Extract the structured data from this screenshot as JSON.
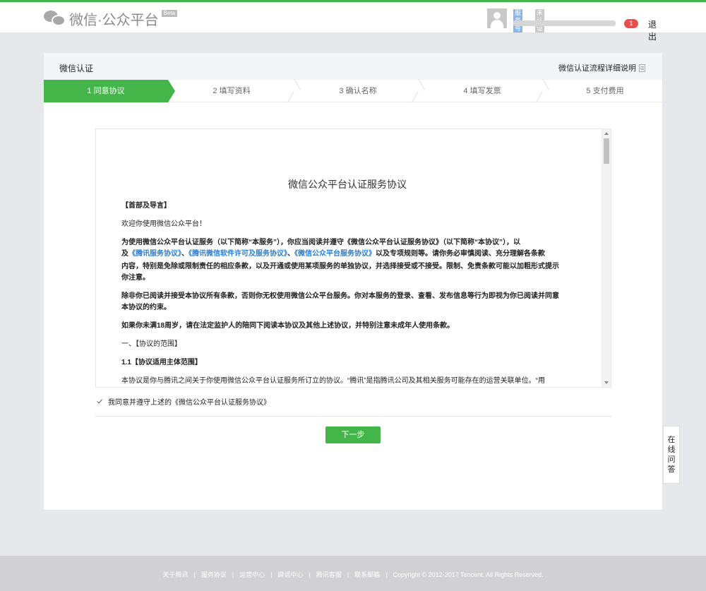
{
  "header": {
    "logo_text": "微信·公众平台",
    "logo_beta": "Beta",
    "account_type": "服务号",
    "account_status": "未认证",
    "notice_count": "1",
    "logout": "退出"
  },
  "card": {
    "title": "微信认证",
    "process_link": "微信认证流程详细说明"
  },
  "steps": [
    {
      "label": "1 同意协议",
      "active": true
    },
    {
      "label": "2 填写资料",
      "active": false
    },
    {
      "label": "3 确认名称",
      "active": false
    },
    {
      "label": "4 填写发票",
      "active": false
    },
    {
      "label": "5 支付费用",
      "active": false
    }
  ],
  "agreement": {
    "title": "微信公众平台认证服务协议",
    "section_head": "【首部及导言】",
    "welcome": "欢迎你使用微信公众平台！",
    "p1_a": "为使用微信公众平台认证服务（以下简称“本服务”），你应当阅读并遵守《微信公众平台认证服务协议》（以下简称“本协议”），以",
    "p1_b_prefix": "及",
    "link1": "《腾讯服务协议》",
    "link2": "《腾讯微信软件许可及服务协议》",
    "link3": "《微信公众平台服务协议》",
    "p1_b_suffix": "以及专项规则等。请你务必审慎阅读、充分理解各条款",
    "p1_c": "内容，特别是免除或限制责任的相应条款，以及开通或使用某项服务的单独协议，并选择接受或不接受。限制、免责条款可能以加粗形式提示",
    "p1_d": "你注意。",
    "p2_a": "除非你已阅读并接受本协议所有条款，否则你无权使用微信公众平台服务。你对本服务的登录、查看、发布信息等行为即视为你已阅读并同意",
    "p2_b": "本协议的约束。",
    "p3": "如果你未满18周岁，请在法定监护人的陪同下阅读本协议及其他上述协议，并特别注意未成年人使用条款。",
    "s1": "一、【协议的范围】",
    "s1_1": "1.1【协议适用主体范围】",
    "p4": "本协议是你与腾讯之间关于你使用微信公众平台认证服务所订立的协议。“腾讯”是指腾讯公司及其相关服务可能存在的运营关联单位。“用"
  },
  "agree_label": "我同意并遵守上述的《微信公众平台认证服务协议》",
  "next_button": "下一步",
  "online_help": [
    "在",
    "线",
    "问",
    "答"
  ],
  "footer": {
    "links": [
      "关于腾讯",
      "服务协议",
      "运营中心",
      "辟谣中心",
      "腾讯客服",
      "联系邮箱"
    ],
    "copyright": "Copyright © 2012-2017 Tencent. All Rights Reserved."
  }
}
